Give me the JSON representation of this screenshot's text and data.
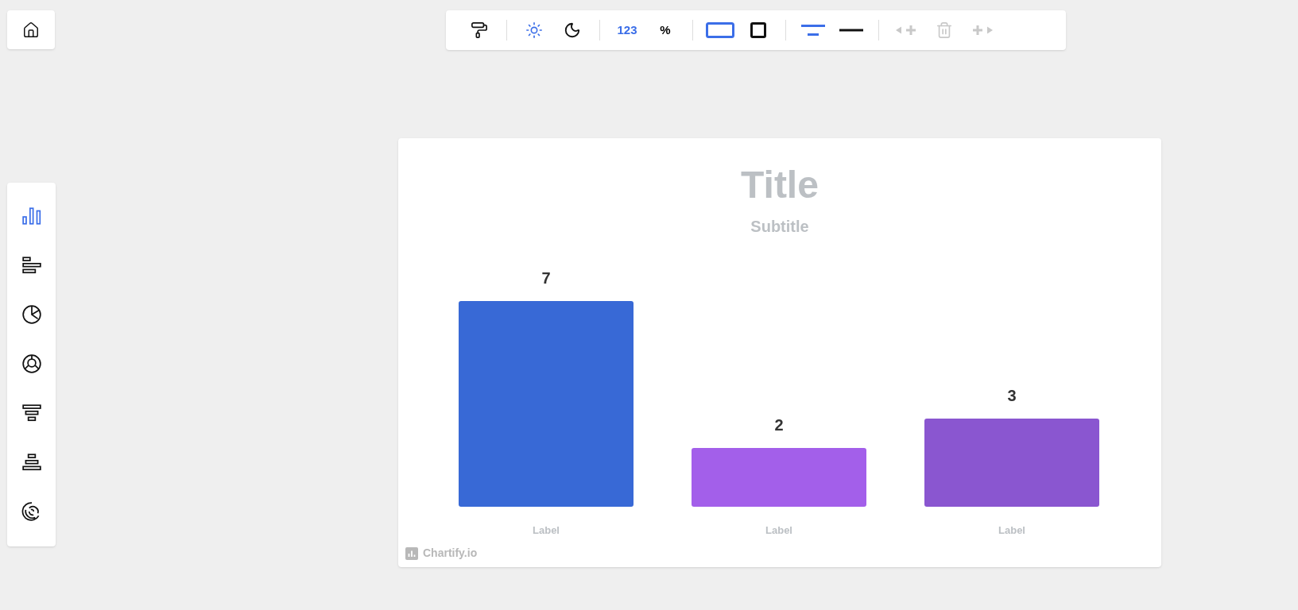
{
  "sidebar": {
    "items": [
      {
        "kind": "bar",
        "selected": true
      },
      {
        "kind": "horizontal-bar",
        "selected": false
      },
      {
        "kind": "pie",
        "selected": false
      },
      {
        "kind": "donut",
        "selected": false
      },
      {
        "kind": "funnel",
        "selected": false
      },
      {
        "kind": "pyramid",
        "selected": false
      },
      {
        "kind": "radial",
        "selected": false
      }
    ]
  },
  "toolbar": {
    "groups": [
      [
        {
          "kind": "roller"
        }
      ],
      [
        {
          "kind": "sun",
          "selected": true
        },
        {
          "kind": "moon",
          "selected": false
        }
      ],
      [
        {
          "kind": "text",
          "label": "123",
          "selected": true
        },
        {
          "kind": "text",
          "label": "%",
          "selected": false
        }
      ],
      [
        {
          "kind": "wide-frame",
          "selected": true
        },
        {
          "kind": "square-frame",
          "selected": false
        }
      ],
      [
        {
          "kind": "two-lines",
          "selected": true
        },
        {
          "kind": "line",
          "selected": false
        }
      ],
      [
        {
          "kind": "add-left",
          "disabled": true
        },
        {
          "kind": "trash",
          "disabled": true
        },
        {
          "kind": "add-right",
          "disabled": true
        }
      ]
    ]
  },
  "chart": {
    "subtitle": "Subtitle",
    "bars": [
      {
        "color": "#3869d6"
      },
      {
        "color": "#a35fea"
      },
      {
        "color": "#8a56d0"
      }
    ],
    "chart_data": {
      "type": "bar",
      "title": "Title",
      "categories": [
        "Label",
        "Label",
        "Label"
      ],
      "values": [
        7,
        2,
        3
      ],
      "data_labels": true
    },
    "footer": "Chartify.io"
  }
}
